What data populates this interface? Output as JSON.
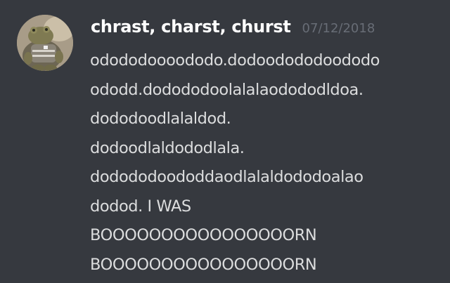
{
  "message": {
    "author": "chrast, charst, churst",
    "timestamp": "07/12/2018",
    "lines": [
      "odododoooododo.dodoodododoododo",
      "ododd.dodododoolalalaodododldoa.",
      "dododoodlalaldod.",
      "dodoodlaldododlala.",
      "dodododoododdaodlalaldododoalao",
      "dodod. I WAS",
      "BOOOOOOOOOOOOOOOORN",
      "BOOOOOOOOOOOOOOOORN"
    ]
  }
}
